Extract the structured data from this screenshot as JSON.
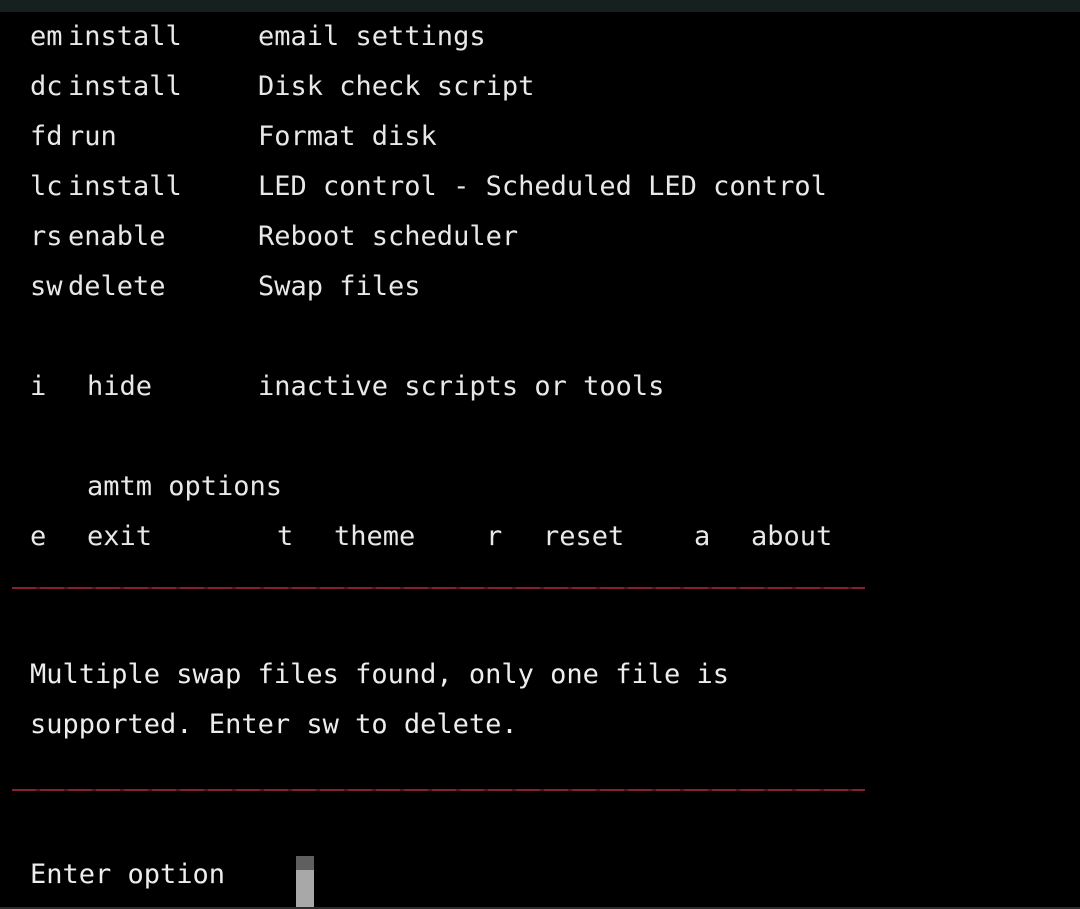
{
  "window": {
    "background_color": "#000000",
    "titlebar_color": "#15201f",
    "text_color": "#e8e8e8",
    "rule_color": "#8f2230",
    "cursor_color": "#a8a8a8"
  },
  "menu": {
    "entries": [
      {
        "key": "em",
        "action": "install",
        "description": "email settings"
      },
      {
        "key": "dc",
        "action": "install",
        "description": "Disk check script"
      },
      {
        "key": "fd",
        "action": "run",
        "description": "Format disk"
      },
      {
        "key": "lc",
        "action": "install",
        "description": "LED control - Scheduled LED control"
      },
      {
        "key": "rs",
        "action": "enable",
        "description": "Reboot scheduler"
      },
      {
        "key": "sw",
        "action": "delete",
        "description": "Swap files"
      }
    ],
    "hide_entry": {
      "key": "i",
      "action": "hide",
      "description": "inactive scripts or tools"
    },
    "options_heading": "amtm options",
    "options": [
      {
        "key": "e",
        "label": "exit"
      },
      {
        "key": "t",
        "label": "theme"
      },
      {
        "key": "r",
        "label": "reset"
      },
      {
        "key": "a",
        "label": "about"
      }
    ]
  },
  "message": {
    "line1": "Multiple swap files found, only one file is",
    "line2": "supported. Enter sw to delete."
  },
  "prompt": {
    "label": "Enter option",
    "input_value": ""
  }
}
